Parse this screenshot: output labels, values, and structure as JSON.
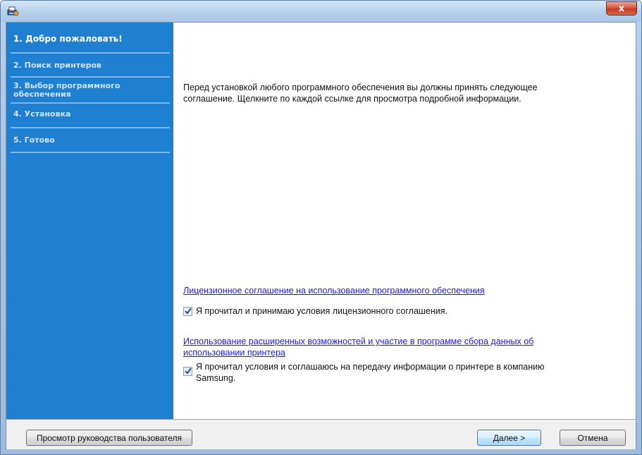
{
  "window": {
    "close_glyph": "x"
  },
  "sidebar": {
    "steps": [
      {
        "label": "1. Добро пожаловать!"
      },
      {
        "label": "2. Поиск принтеров"
      },
      {
        "label": "3. Выбор программного"
      },
      {
        "label": "обеспечения"
      },
      {
        "label": "4. Установка"
      },
      {
        "label": "5. Готово"
      }
    ]
  },
  "main": {
    "intro_line1": "Перед установкой любого программного обеспечения вы должны принять следующее",
    "intro_line2": "соглашение. Щелкните по каждой ссылке для просмотра подробной информации.",
    "license_link": "Лицензионное соглашение на использование программного обеспечения",
    "license_check": "Я прочитал и принимаю условия лицензионного соглашения.",
    "advanced_link_line1": "Использование расширенных возможностей и участие в программе сбора данных об",
    "advanced_link_line2": "использовании принтера",
    "advanced_check_line1": "Я прочитал условия и соглашаюсь на передачу информации о принтере в компанию",
    "advanced_check_line2": "Samsung."
  },
  "buttons": {
    "user_guide": "Просмотр руководства пользователя",
    "next": "Далее >",
    "cancel": "Отмена"
  },
  "icons": {
    "app": "installer-icon",
    "close": "close-icon",
    "check": "check-icon"
  }
}
